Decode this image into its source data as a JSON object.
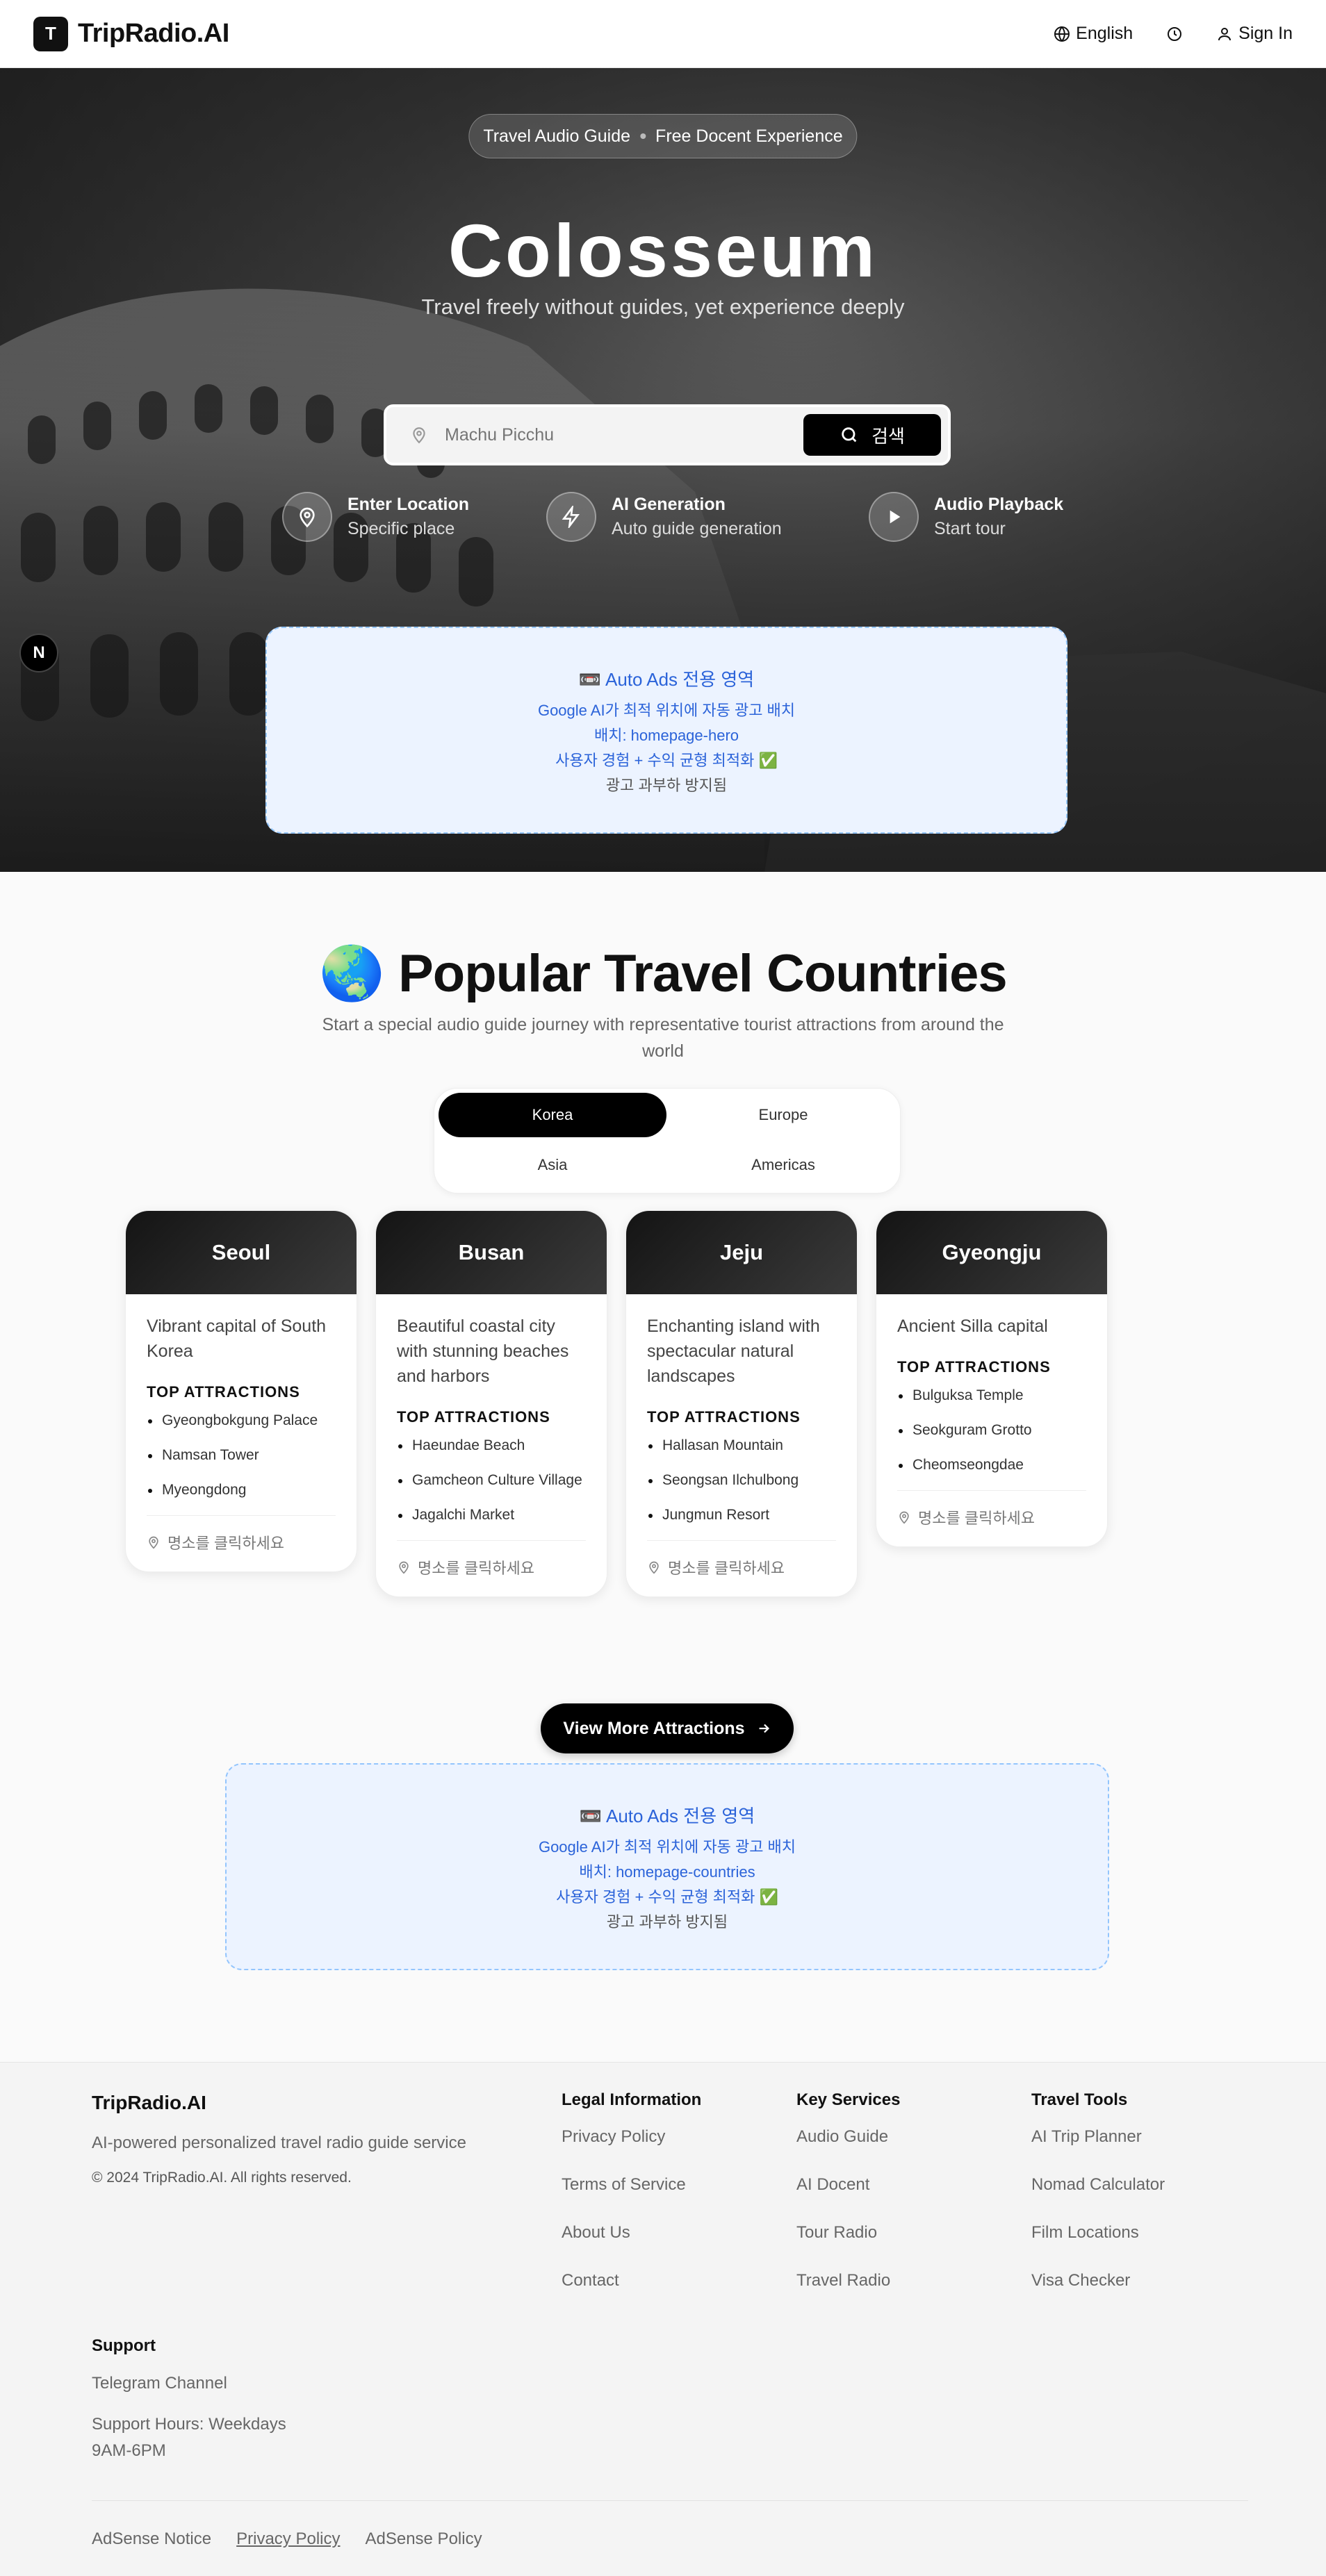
{
  "header": {
    "logo_mark": "T",
    "logo_text": "TripRadio.AI",
    "language": "English",
    "signin": "Sign In"
  },
  "hero": {
    "pill_left": "Travel Audio Guide",
    "pill_right": "Free Docent Experience",
    "title": "Colosseum",
    "subtitle": "Travel freely without guides, yet experience deeply",
    "search_placeholder": "Machu Picchu",
    "search_button": "검색",
    "steps": [
      {
        "title": "Enter Location",
        "desc": "Specific place"
      },
      {
        "title": "AI Generation",
        "desc": "Auto guide generation"
      },
      {
        "title": "Audio Playback",
        "desc": "Start tour"
      }
    ],
    "n_badge": "N"
  },
  "ad_hero": {
    "title": "📼 Auto Ads 전용 영역",
    "line1": "Google AI가 최적 위치에 자동 광고 배치",
    "line2": "배치: homepage-hero",
    "line3": "사용자 경험 + 수익 균형 최적화 ✅",
    "line4": "광고 과부하 방지됨"
  },
  "countries": {
    "title": "🌏 Popular Travel Countries",
    "subtitle": "Start a special audio guide journey with representative tourist attractions from around the world",
    "tabs": [
      "Korea",
      "Europe",
      "Asia",
      "Americas"
    ],
    "active_tab": "Korea",
    "attractions_label": "TOP ATTRACTIONS",
    "click_hint": "명소를 클릭하세요",
    "cards": [
      {
        "city": "Seoul",
        "desc": "Vibrant capital of South Korea",
        "attractions": [
          "Gyeongbokgung Palace",
          "Namsan Tower",
          "Myeongdong"
        ]
      },
      {
        "city": "Busan",
        "desc": "Beautiful coastal city with stunning beaches and harbors",
        "attractions": [
          "Haeundae Beach",
          "Gamcheon Culture Village",
          "Jagalchi Market"
        ]
      },
      {
        "city": "Jeju",
        "desc": "Enchanting island with spectacular natural landscapes",
        "attractions": [
          "Hallasan Mountain",
          "Seongsan Ilchulbong",
          "Jungmun Resort"
        ]
      },
      {
        "city": "Gyeongju",
        "desc": "Ancient Silla capital",
        "attractions": [
          "Bulguksa Temple",
          "Seokguram Grotto",
          "Cheomseongdae"
        ]
      }
    ],
    "more_button": "View More Attractions"
  },
  "ad_countries": {
    "title": "📼 Auto Ads 전용 영역",
    "line1": "Google AI가 최적 위치에 자동 광고 배치",
    "line2": "배치: homepage-countries",
    "line3": "사용자 경험 + 수익 균형 최적화 ✅",
    "line4": "광고 과부하 방지됨"
  },
  "footer": {
    "brand": "TripRadio.AI",
    "tagline": "AI-powered personalized travel radio guide service",
    "copyright": "© 2024 TripRadio.AI. All rights reserved.",
    "legal": {
      "title": "Legal Information",
      "links": [
        "Privacy Policy",
        "Terms of Service",
        "About Us",
        "Contact"
      ]
    },
    "services": {
      "title": "Key Services",
      "links": [
        "Audio Guide",
        "AI Docent",
        "Tour Radio",
        "Travel Radio"
      ]
    },
    "tools": {
      "title": "Travel Tools",
      "links": [
        "AI Trip Planner",
        "Nomad Calculator",
        "Film Locations",
        "Visa Checker"
      ]
    },
    "support": {
      "title": "Support",
      "telegram": "Telegram Channel",
      "hours": "Support Hours: Weekdays 9AM-6PM"
    },
    "bottom": [
      "AdSense Notice",
      "Privacy Policy",
      "AdSense Policy"
    ]
  }
}
